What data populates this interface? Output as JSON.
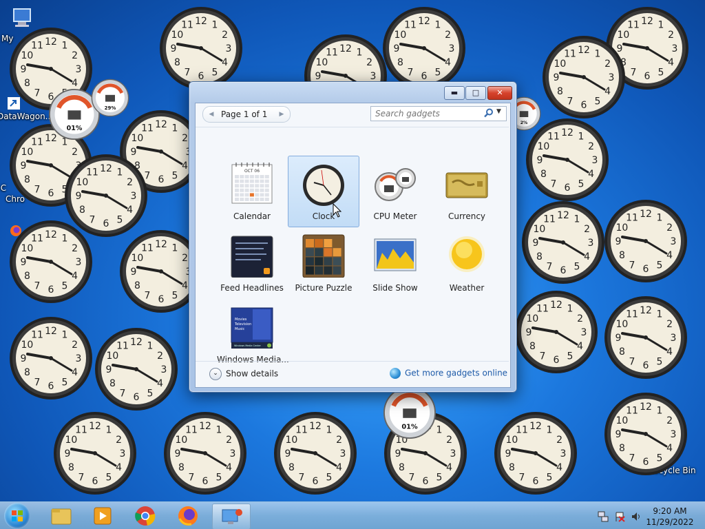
{
  "desktop": {
    "icons": [
      {
        "label": "My",
        "icon": "computer-icon"
      },
      {
        "label": "DataWagon...",
        "icon": "shortcut-icon"
      },
      {
        "label": "C",
        "icon": "shortcut-icon"
      },
      {
        "label": "Chro",
        "icon": "chrome-icon"
      },
      {
        "label": "Recycle Bin",
        "icon": "recycle-bin-icon"
      }
    ],
    "meters": [
      {
        "label": "01%"
      },
      {
        "label": "29%"
      },
      {
        "label": "2%"
      },
      {
        "label": "01%"
      }
    ],
    "clock_face": {
      "numerals": [
        "12",
        "1",
        "2",
        "3",
        "4",
        "5",
        "6",
        "7",
        "8",
        "9",
        "10",
        "11"
      ]
    }
  },
  "window": {
    "pager_label": "Page 1 of 1",
    "search_placeholder": "Search gadgets",
    "gadgets": [
      {
        "label": "Calendar",
        "icon": "calendar-icon",
        "selected": false,
        "month": "OCT 06"
      },
      {
        "label": "Clock",
        "icon": "clock-icon",
        "selected": true
      },
      {
        "label": "CPU Meter",
        "icon": "cpu-meter-icon",
        "selected": false
      },
      {
        "label": "Currency",
        "icon": "currency-icon",
        "selected": false
      },
      {
        "label": "Feed Headlines",
        "icon": "feed-icon",
        "selected": false
      },
      {
        "label": "Picture Puzzle",
        "icon": "puzzle-icon",
        "selected": false
      },
      {
        "label": "Slide Show",
        "icon": "slideshow-icon",
        "selected": false
      },
      {
        "label": "Weather",
        "icon": "weather-icon",
        "selected": false
      },
      {
        "label": "Windows Media...",
        "icon": "media-center-icon",
        "selected": false,
        "menu": [
          "Movies",
          "Television",
          "Music"
        ],
        "footer": "Windows Media Center"
      }
    ],
    "show_details": "Show details",
    "get_more": "Get more gadgets online"
  },
  "taskbar": {
    "time": "9:20 AM",
    "date": "11/29/2022",
    "apps": [
      "explorer-icon",
      "media-player-icon",
      "chrome-icon",
      "firefox-icon",
      "gadgets-icon"
    ]
  },
  "colors": {
    "accent": "#1d5aa8",
    "selection": "#c2dcf6",
    "close": "#d6432c"
  }
}
